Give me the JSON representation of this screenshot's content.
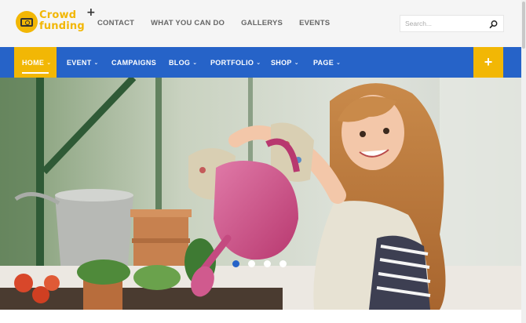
{
  "logo": {
    "line1": "Crowd",
    "line2": "funding",
    "plus": "+"
  },
  "top_nav": [
    "CONTACT",
    "WHAT YOU CAN DO",
    "GALLERYS",
    "EVENTS"
  ],
  "search": {
    "placeholder": "Search...",
    "icon": "search-icon"
  },
  "main_nav": [
    {
      "label": "HOME",
      "has_dropdown": true,
      "active": true
    },
    {
      "label": "EVENT",
      "has_dropdown": true
    },
    {
      "label": "CAMPAIGNS",
      "has_dropdown": false
    },
    {
      "label": "BLOG",
      "has_dropdown": true
    },
    {
      "label": "PORTFOLIO",
      "has_dropdown": true
    },
    {
      "label": "SHOP",
      "has_dropdown": true
    },
    {
      "label": "PAGE",
      "has_dropdown": true
    }
  ],
  "plus_button": "+",
  "hero": {
    "slides": 4,
    "active_slide": 1
  },
  "colors": {
    "primary": "#2663c8",
    "accent": "#f2b705",
    "header_bg": "#f5f5f5"
  }
}
